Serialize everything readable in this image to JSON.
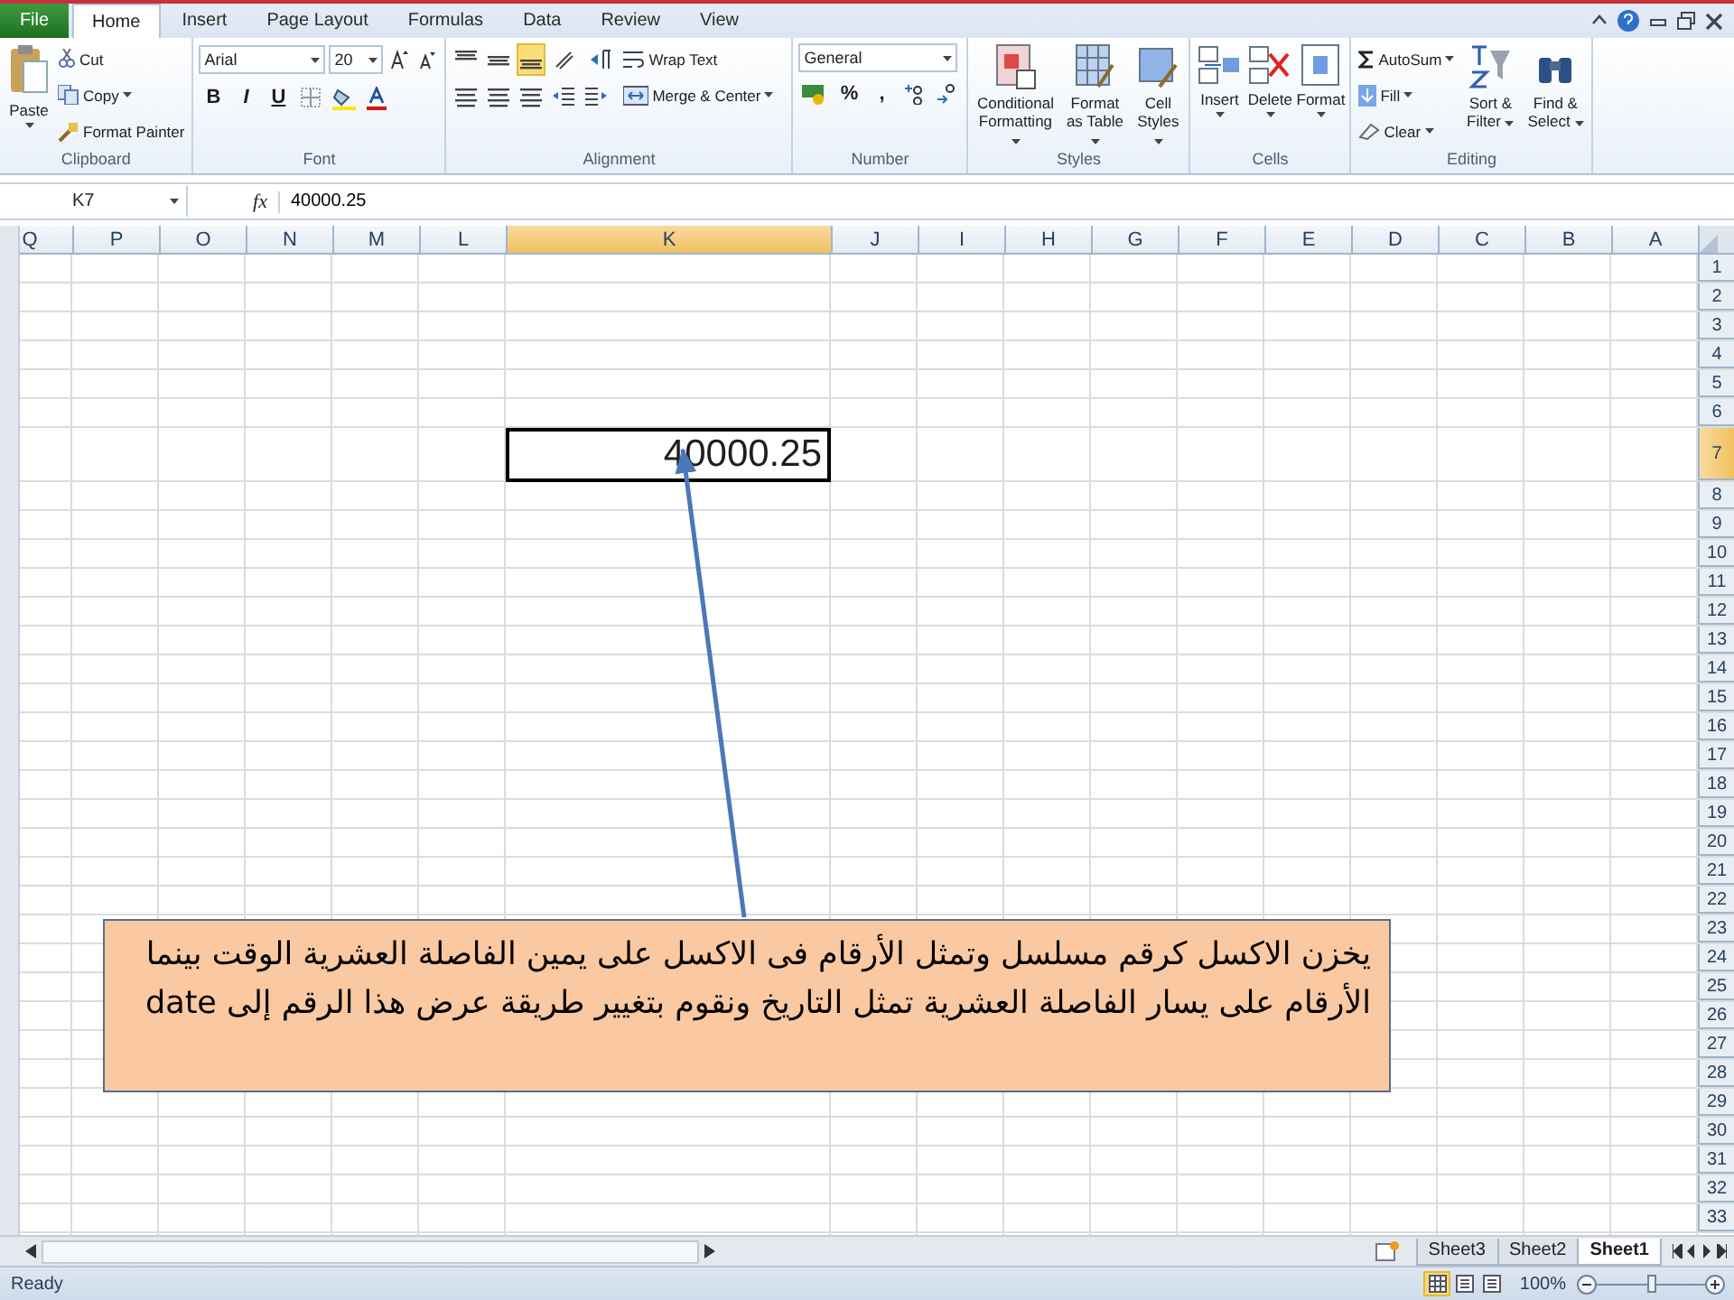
{
  "menu_tabs": [
    {
      "label": "File",
      "kind": "file",
      "selected": false
    },
    {
      "label": "Home",
      "kind": "tab",
      "selected": true
    },
    {
      "label": "Insert",
      "kind": "tab",
      "selected": false
    },
    {
      "label": "Page Layout",
      "kind": "tab",
      "selected": false
    },
    {
      "label": "Formulas",
      "kind": "tab",
      "selected": false
    },
    {
      "label": "Data",
      "kind": "tab",
      "selected": false
    },
    {
      "label": "Review",
      "kind": "tab",
      "selected": false
    },
    {
      "label": "View",
      "kind": "tab",
      "selected": false
    }
  ],
  "ribbon": {
    "clipboard": {
      "title": "Clipboard",
      "paste": "Paste",
      "cut": "Cut",
      "copy": "Copy",
      "format_painter": "Format Painter"
    },
    "font": {
      "title": "Font",
      "font_name": "Arial",
      "font_size": "20",
      "bold": "B",
      "italic": "I",
      "underline": "U"
    },
    "alignment": {
      "title": "Alignment",
      "vertical_align": [
        {
          "selected": false
        },
        {
          "selected": false
        },
        {
          "selected": true
        }
      ],
      "wrap_text": "Wrap Text",
      "merge_center": "Merge & Center"
    },
    "number": {
      "title": "Number",
      "format": "General",
      "percent": "%",
      "comma": ","
    },
    "styles": {
      "title": "Styles",
      "buttons": [
        "Conditional Formatting",
        "Format as Table",
        "Cell Styles"
      ]
    },
    "cells": {
      "title": "Cells",
      "buttons": [
        "Insert",
        "Delete",
        "Format"
      ]
    },
    "editing": {
      "title": "Editing",
      "autosum": "AutoSum",
      "fill": "Fill",
      "clear": "Clear",
      "sort_filter": "Sort & Filter",
      "find_select": "Find & Select"
    }
  },
  "formula_bar": {
    "name_box": "K7",
    "fx": "fx",
    "value": "40000.25"
  },
  "sheet": {
    "columns": [
      {
        "label": "Q",
        "kind": "normal",
        "selected": false
      },
      {
        "label": "P",
        "kind": "normal",
        "selected": false
      },
      {
        "label": "O",
        "kind": "normal",
        "selected": false
      },
      {
        "label": "N",
        "kind": "normal",
        "selected": false
      },
      {
        "label": "M",
        "kind": "normal",
        "selected": false
      },
      {
        "label": "L",
        "kind": "normal",
        "selected": false
      },
      {
        "label": "K",
        "kind": "wide",
        "selected": true
      },
      {
        "label": "J",
        "kind": "normal",
        "selected": false
      },
      {
        "label": "I",
        "kind": "normal",
        "selected": false
      },
      {
        "label": "H",
        "kind": "normal",
        "selected": false
      },
      {
        "label": "G",
        "kind": "normal",
        "selected": false
      },
      {
        "label": "F",
        "kind": "normal",
        "selected": false
      },
      {
        "label": "E",
        "kind": "normal",
        "selected": false
      },
      {
        "label": "D",
        "kind": "normal",
        "selected": false
      },
      {
        "label": "C",
        "kind": "normal",
        "selected": false
      },
      {
        "label": "B",
        "kind": "normal",
        "selected": false
      },
      {
        "label": "A",
        "kind": "normal",
        "selected": false
      }
    ],
    "rows": [
      {
        "label": "1",
        "kind": "normal",
        "selected": false
      },
      {
        "label": "2",
        "kind": "normal",
        "selected": false
      },
      {
        "label": "3",
        "kind": "normal",
        "selected": false
      },
      {
        "label": "4",
        "kind": "normal",
        "selected": false
      },
      {
        "label": "5",
        "kind": "normal",
        "selected": false
      },
      {
        "label": "6",
        "kind": "normal",
        "selected": false
      },
      {
        "label": "7",
        "kind": "tall",
        "selected": true
      },
      {
        "label": "8",
        "kind": "normal",
        "selected": false
      },
      {
        "label": "9",
        "kind": "normal",
        "selected": false
      },
      {
        "label": "10",
        "kind": "normal",
        "selected": false
      },
      {
        "label": "11",
        "kind": "normal",
        "selected": false
      },
      {
        "label": "12",
        "kind": "normal",
        "selected": false
      },
      {
        "label": "13",
        "kind": "normal",
        "selected": false
      },
      {
        "label": "14",
        "kind": "normal",
        "selected": false
      },
      {
        "label": "15",
        "kind": "normal",
        "selected": false
      },
      {
        "label": "16",
        "kind": "normal",
        "selected": false
      },
      {
        "label": "17",
        "kind": "normal",
        "selected": false
      },
      {
        "label": "18",
        "kind": "normal",
        "selected": false
      },
      {
        "label": "19",
        "kind": "normal",
        "selected": false
      },
      {
        "label": "20",
        "kind": "normal",
        "selected": false
      },
      {
        "label": "21",
        "kind": "normal",
        "selected": false
      },
      {
        "label": "22",
        "kind": "normal",
        "selected": false
      },
      {
        "label": "23",
        "kind": "normal",
        "selected": false
      },
      {
        "label": "24",
        "kind": "normal",
        "selected": false
      },
      {
        "label": "25",
        "kind": "normal",
        "selected": false
      },
      {
        "label": "26",
        "kind": "normal",
        "selected": false
      },
      {
        "label": "27",
        "kind": "normal",
        "selected": false
      },
      {
        "label": "28",
        "kind": "normal",
        "selected": false
      },
      {
        "label": "29",
        "kind": "normal",
        "selected": false
      },
      {
        "label": "30",
        "kind": "normal",
        "selected": false
      },
      {
        "label": "31",
        "kind": "normal",
        "selected": false
      },
      {
        "label": "32",
        "kind": "normal",
        "selected": false
      },
      {
        "label": "33",
        "kind": "normal",
        "selected": false
      }
    ],
    "active_cell": {
      "value": "40000.25"
    }
  },
  "callout": {
    "text": "يخزن الاكسل كرقم مسلسل وتمثل الأرقام فى الاكسل على يمين الفاصلة العشرية الوقت بينما الأرقام على يسار الفاصلة العشرية تمثل التاريخ ونقوم بتغيير طريقة عرض هذا الرقم إلى date"
  },
  "sheet_tabs": [
    {
      "label": "Sheet3",
      "selected": false
    },
    {
      "label": "Sheet2",
      "selected": false
    },
    {
      "label": "Sheet1",
      "selected": true
    }
  ],
  "status_bar": {
    "text": "Ready",
    "views": [
      {
        "selected": true
      },
      {
        "selected": false
      },
      {
        "selected": false
      }
    ],
    "zoom": "100%",
    "zoom_slider": {
      "level": 0.5
    }
  }
}
